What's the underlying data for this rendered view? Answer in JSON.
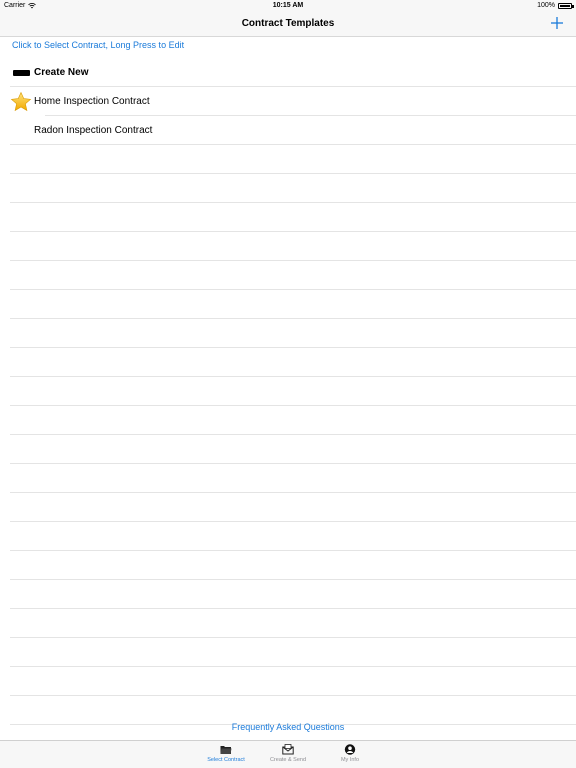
{
  "status": {
    "carrier": "Carrier",
    "time": "10:15 AM",
    "battery": "100%"
  },
  "nav": {
    "title": "Contract Templates",
    "add_icon": "plus-icon"
  },
  "hint": "Click to Select Contract, Long Press to Edit",
  "rows": {
    "create_new": "Create New",
    "home": "Home Inspection Contract",
    "radon": "Radon Inspection Contract"
  },
  "faq": "Frequently Asked Questions",
  "tabs": [
    {
      "label": "Select Contract",
      "icon": "folder-icon",
      "active": true
    },
    {
      "label": "Create & Send",
      "icon": "envelope-icon",
      "active": false
    },
    {
      "label": "My Info",
      "icon": "user-icon",
      "active": false
    }
  ],
  "colors": {
    "accent": "#1a7ad9",
    "star": "#f5b400"
  }
}
